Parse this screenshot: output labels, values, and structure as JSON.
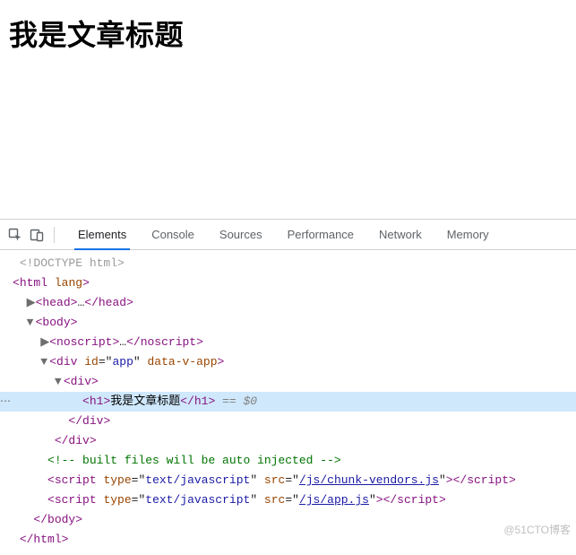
{
  "page": {
    "h1_text": "我是文章标题"
  },
  "devtools": {
    "tabs": {
      "elements": "Elements",
      "console": "Console",
      "sources": "Sources",
      "performance": "Performance",
      "network": "Network",
      "memory": "Memory"
    },
    "dom": {
      "doctype": "<!DOCTYPE html>",
      "html_open": {
        "tag": "html",
        "attr_name": "lang"
      },
      "head": {
        "tag": "head",
        "ellipsis": "…"
      },
      "body_open": {
        "tag": "body"
      },
      "noscript": {
        "tag": "noscript",
        "ellipsis": "…"
      },
      "app_div": {
        "tag": "div",
        "id_attr": "id",
        "id_val": "app",
        "data_attr": "data-v-app"
      },
      "inner_div": {
        "tag": "div"
      },
      "h1_line": {
        "tag": "h1",
        "text": "我是文章标题",
        "selector": " == $0"
      },
      "close_div1": "div",
      "close_div2": "div",
      "comment": "<!-- built files will be auto injected -->",
      "script1": {
        "tag": "script",
        "type_attr": "type",
        "type_val": "text/javascript",
        "src_attr": "src",
        "src_val": "/js/chunk-vendors.js"
      },
      "script2": {
        "tag": "script",
        "type_attr": "type",
        "type_val": "text/javascript",
        "src_attr": "src",
        "src_val": "/js/app.js"
      },
      "close_body": "body",
      "close_html": "html"
    }
  },
  "watermark": "@51CTO博客"
}
